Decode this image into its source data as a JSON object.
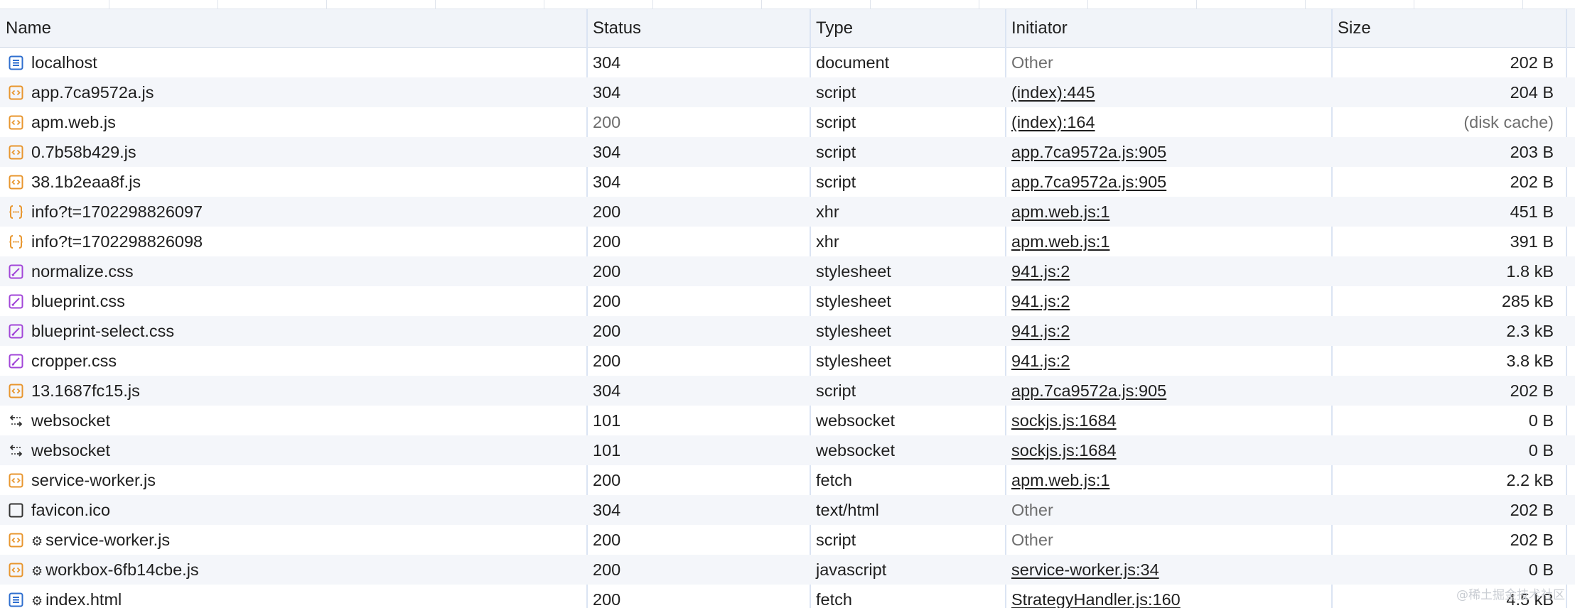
{
  "columns": {
    "name": "Name",
    "status": "Status",
    "type": "Type",
    "initiator": "Initiator",
    "size": "Size"
  },
  "rows": [
    {
      "name": "localhost",
      "icon": "document-icon",
      "status": "304",
      "type": "document",
      "initiator": "Other",
      "initiator_link": false,
      "size": "202 B"
    },
    {
      "name": "app.7ca9572a.js",
      "icon": "script-icon",
      "status": "304",
      "type": "script",
      "initiator": "(index):445",
      "initiator_link": true,
      "size": "204 B"
    },
    {
      "name": "apm.web.js",
      "icon": "script-icon",
      "status": "200",
      "status_dim": true,
      "type": "script",
      "initiator": "(index):164",
      "initiator_link": true,
      "size": "(disk cache)",
      "size_dim": true
    },
    {
      "name": "0.7b58b429.js",
      "icon": "script-icon",
      "status": "304",
      "type": "script",
      "initiator": "app.7ca9572a.js:905",
      "initiator_link": true,
      "size": "203 B"
    },
    {
      "name": "38.1b2eaa8f.js",
      "icon": "script-icon",
      "status": "304",
      "type": "script",
      "initiator": "app.7ca9572a.js:905",
      "initiator_link": true,
      "size": "202 B"
    },
    {
      "name": "info?t=1702298826097",
      "icon": "xhr-icon",
      "status": "200",
      "type": "xhr",
      "initiator": "apm.web.js:1",
      "initiator_link": true,
      "size": "451 B"
    },
    {
      "name": "info?t=1702298826098",
      "icon": "xhr-icon",
      "status": "200",
      "type": "xhr",
      "initiator": "apm.web.js:1",
      "initiator_link": true,
      "size": "391 B"
    },
    {
      "name": "normalize.css",
      "icon": "stylesheet-icon",
      "status": "200",
      "type": "stylesheet",
      "initiator": "941.js:2",
      "initiator_link": true,
      "size": "1.8 kB"
    },
    {
      "name": "blueprint.css",
      "icon": "stylesheet-icon",
      "status": "200",
      "type": "stylesheet",
      "initiator": "941.js:2",
      "initiator_link": true,
      "size": "285 kB"
    },
    {
      "name": "blueprint-select.css",
      "icon": "stylesheet-icon",
      "status": "200",
      "type": "stylesheet",
      "initiator": "941.js:2",
      "initiator_link": true,
      "size": "2.3 kB"
    },
    {
      "name": "cropper.css",
      "icon": "stylesheet-icon",
      "status": "200",
      "type": "stylesheet",
      "initiator": "941.js:2",
      "initiator_link": true,
      "size": "3.8 kB"
    },
    {
      "name": "13.1687fc15.js",
      "icon": "script-icon",
      "status": "304",
      "type": "script",
      "initiator": "app.7ca9572a.js:905",
      "initiator_link": true,
      "size": "202 B"
    },
    {
      "name": "websocket",
      "icon": "websocket-icon",
      "status": "101",
      "type": "websocket",
      "initiator": "sockjs.js:1684",
      "initiator_link": true,
      "size": "0 B"
    },
    {
      "name": "websocket",
      "icon": "websocket-icon",
      "status": "101",
      "type": "websocket",
      "initiator": "sockjs.js:1684",
      "initiator_link": true,
      "size": "0 B"
    },
    {
      "name": "service-worker.js",
      "icon": "script-icon",
      "status": "200",
      "type": "fetch",
      "initiator": "apm.web.js:1",
      "initiator_link": true,
      "size": "2.2 kB"
    },
    {
      "name": "favicon.ico",
      "icon": "other-icon",
      "status": "304",
      "type": "text/html",
      "initiator": "Other",
      "initiator_link": false,
      "size": "202 B"
    },
    {
      "name": "service-worker.js",
      "icon": "script-icon",
      "gear": true,
      "status": "200",
      "type": "script",
      "initiator": "Other",
      "initiator_link": false,
      "size": "202 B"
    },
    {
      "name": "workbox-6fb14cbe.js",
      "icon": "script-icon",
      "gear": true,
      "status": "200",
      "type": "javascript",
      "initiator": "service-worker.js:34",
      "initiator_link": true,
      "size": "0 B"
    },
    {
      "name": "index.html",
      "icon": "document-icon",
      "gear": true,
      "status": "200",
      "type": "fetch",
      "initiator": "StrategyHandler.js:160",
      "initiator_link": true,
      "size": "4.5 kB"
    }
  ],
  "gear_glyph": "⚙",
  "watermark": "@稀土掘金技术社区",
  "colors": {
    "document": "#2f6fcf",
    "script": "#e8962e",
    "xhr": "#e8962e",
    "stylesheet": "#a246d8",
    "websocket": "#333333",
    "other": "#333333"
  }
}
